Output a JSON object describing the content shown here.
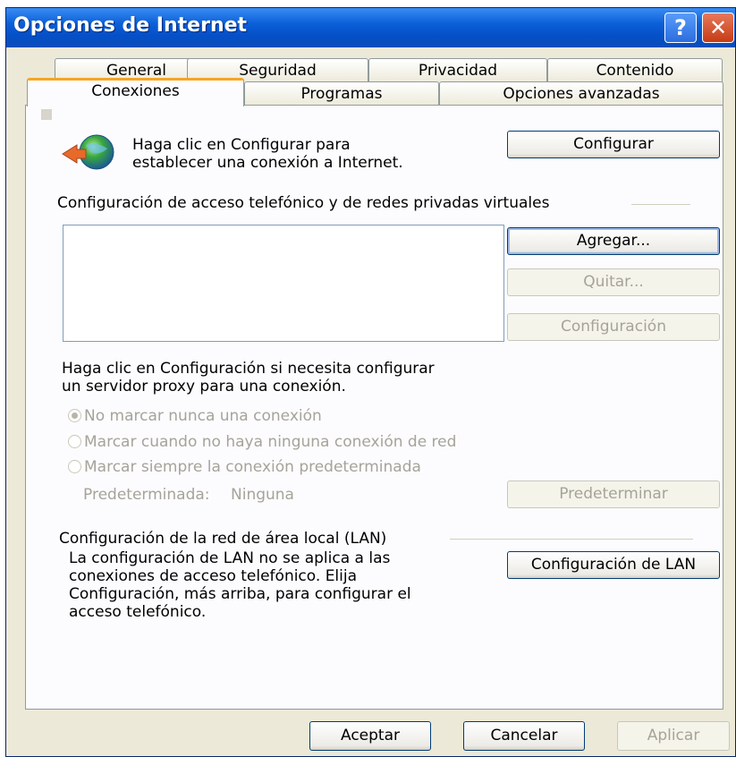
{
  "window": {
    "title": "Opciones de Internet",
    "help_glyph": "?",
    "close_glyph": "✕"
  },
  "tabs": {
    "row1": [
      "General",
      "Seguridad",
      "Privacidad",
      "Contenido"
    ],
    "row2": [
      "Conexiones",
      "Programas",
      "Opciones avanzadas"
    ],
    "active": "Conexiones"
  },
  "setup": {
    "icon": "network-globe-icon",
    "text_line1": "Haga clic en Configurar para",
    "text_line2": "establecer una conexión a Internet.",
    "button": "Configurar"
  },
  "dialup": {
    "heading": "Configuración de acceso telefónico y de redes privadas virtuales",
    "items": [],
    "add_button": "Agregar...",
    "remove_button": "Quitar...",
    "settings_button": "Configuración"
  },
  "proxy": {
    "text_line1": "Haga clic en Configuración si necesita configurar",
    "text_line2": "un servidor proxy para una conexión."
  },
  "dial_options": [
    {
      "label": "No marcar nunca una conexión",
      "selected": true,
      "enabled": false
    },
    {
      "label": "Marcar cuando no haya ninguna conexión de red",
      "selected": false,
      "enabled": false
    },
    {
      "label": "Marcar siempre la conexión predeterminada",
      "selected": false,
      "enabled": false
    }
  ],
  "default_connection": {
    "label": "Predeterminada:",
    "value": "Ninguna",
    "button": "Predeterminar"
  },
  "lan": {
    "heading": "Configuración de la red de área local (LAN)",
    "text_lines": [
      "La configuración de LAN no se aplica a las",
      "conexiones de acceso telefónico. Elija",
      "Configuración, más arriba, para configurar el",
      "acceso telefónico."
    ],
    "button": "Configuración de LAN"
  },
  "footer": {
    "ok": "Aceptar",
    "cancel": "Cancelar",
    "apply": "Aplicar"
  },
  "colors": {
    "titlebar": "#0a5fd8",
    "dialog_bg": "#ece9d8",
    "active_tab_accent": "#f5a623",
    "disabled_text": "#a6a39a"
  }
}
